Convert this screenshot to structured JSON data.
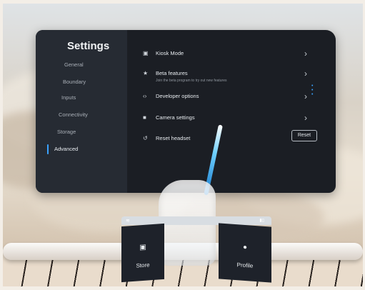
{
  "settings": {
    "title": "Settings",
    "nav": [
      "General",
      "Boundary",
      "Inputs",
      "Connectivity",
      "Storage",
      "Advanced"
    ],
    "active_nav": "Advanced",
    "rows": [
      {
        "icon": "kiosk-icon",
        "label": "Kiosk Mode",
        "subtitle": ""
      },
      {
        "icon": "star-icon",
        "label": "Beta features",
        "subtitle": "Join the beta program to try out new features"
      },
      {
        "icon": "code-icon",
        "label": "Developer options",
        "subtitle": ""
      },
      {
        "icon": "camera-icon",
        "label": "Camera settings",
        "subtitle": ""
      },
      {
        "icon": "reset-icon",
        "label": "Reset headset",
        "subtitle": ""
      }
    ],
    "reset_button": "Reset"
  },
  "dock": {
    "store_label": "Store",
    "profile_label": "Profile"
  },
  "colors": {
    "panel": "#1b1e24",
    "sidebar": "#262b33",
    "accent": "#3aa3ff"
  }
}
